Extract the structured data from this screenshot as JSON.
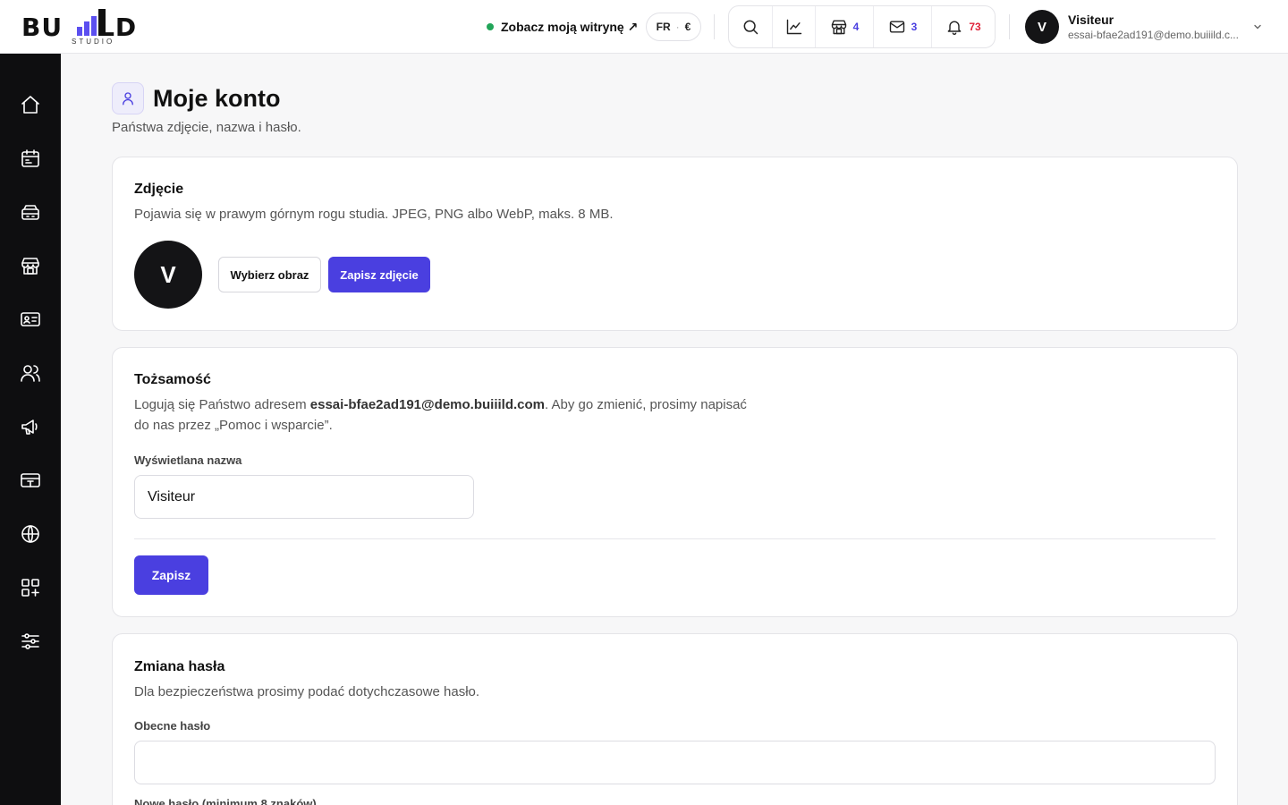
{
  "header": {
    "logo_text": "BU LD",
    "logo_sub": "STUDIO",
    "site_link": "Zobacz moją witrynę ↗",
    "locale": {
      "lang": "FR",
      "sep": "·",
      "currency": "€"
    },
    "tools": {
      "shop_count": "4",
      "mail_count": "3",
      "notif_count": "73"
    },
    "user": {
      "initial": "V",
      "name": "Visiteur",
      "email": "essai-bfae2ad191@demo.buiiild.c..."
    }
  },
  "sidebar": {
    "items": [
      {
        "icon": "home-icon"
      },
      {
        "icon": "calendar-icon"
      },
      {
        "icon": "database-icon"
      },
      {
        "icon": "store-icon"
      },
      {
        "icon": "id-card-icon"
      },
      {
        "icon": "users-icon"
      },
      {
        "icon": "megaphone-icon"
      },
      {
        "icon": "payments-icon"
      },
      {
        "icon": "globe-icon"
      },
      {
        "icon": "apps-add-icon"
      },
      {
        "icon": "sliders-icon"
      }
    ]
  },
  "page": {
    "title": "Moje konto",
    "subtitle": "Państwa zdjęcie, nazwa i hasło."
  },
  "photo_card": {
    "title": "Zdjęcie",
    "desc": "Pojawia się w prawym górnym rogu studia. JPEG, PNG albo WebP, maks. 8 MB.",
    "avatar_initial": "V",
    "choose_label": "Wybierz obraz",
    "save_label": "Zapisz zdjęcie"
  },
  "identity_card": {
    "title": "Tożsamość",
    "desc_prefix": "Logują się Państwo adresem ",
    "email": "essai-bfae2ad191@demo.buiiild.com",
    "desc_suffix": ". Aby go zmienić, prosimy napisać",
    "desc_line2": "do nas przez „Pomoc i wsparcie”.",
    "display_name_label": "Wyświetlana nazwa",
    "display_name_value": "Visiteur",
    "save_label": "Zapisz"
  },
  "password_card": {
    "title": "Zmiana hasła",
    "desc": "Dla bezpieczeństwa prosimy podać dotychczasowe hasło.",
    "current_label": "Obecne hasło",
    "current_value": "",
    "new_label": "Nowe hasło (minimum 8 znaków)"
  },
  "colors": {
    "accent": "#4a3fe0",
    "sidebar_bg": "#0e0e10",
    "status_green": "#22a559",
    "badge_red": "#e0243b"
  }
}
